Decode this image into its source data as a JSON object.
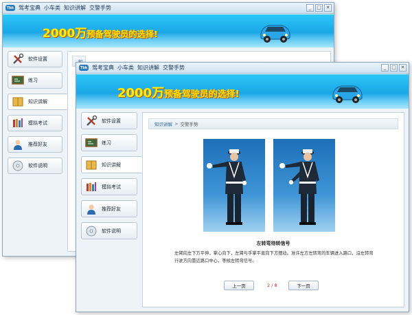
{
  "app": {
    "title": "驾考宝典",
    "menu": [
      "小车类",
      "知识讲解",
      "交警手势"
    ],
    "logo_text": "Tbk"
  },
  "banner": {
    "slogan_number": "2000万",
    "slogan_text": "预备驾驶员的选择!"
  },
  "window_controls": [
    "_",
    "□",
    "✕"
  ],
  "sidebar": {
    "items": [
      {
        "label": "软件设置",
        "icon": "tools-icon"
      },
      {
        "label": "练习",
        "icon": "blackboard-icon"
      },
      {
        "label": "知识讲解",
        "icon": "book-icon"
      },
      {
        "label": "模拟考试",
        "icon": "exam-icon"
      },
      {
        "label": "推荐好友",
        "icon": "person-icon"
      },
      {
        "label": "软件说明",
        "icon": "cd-icon"
      }
    ],
    "active_index": 2
  },
  "back_window": {
    "breadcrumb_fragment": "知"
  },
  "content": {
    "breadcrumb": {
      "link": "知识讲解",
      "separator": ">",
      "current": "交警手势"
    },
    "caption": "左转弯待转信号",
    "description": "左臂向左下方平伸，掌心向下，左臂与手掌平直向下方摆动。准许左方左转弯的车辆进入路口，沿左转弯行驶方向靠近路口中心，等候左转弯信号。",
    "prev_label": "上一页",
    "next_label": "下一页",
    "page_indicator": "2 / 8"
  },
  "colors": {
    "banner_top": "#2cc7f7",
    "slogan": "#fff200",
    "link": "#2d6ca2",
    "page_indicator": "#dd2222"
  }
}
